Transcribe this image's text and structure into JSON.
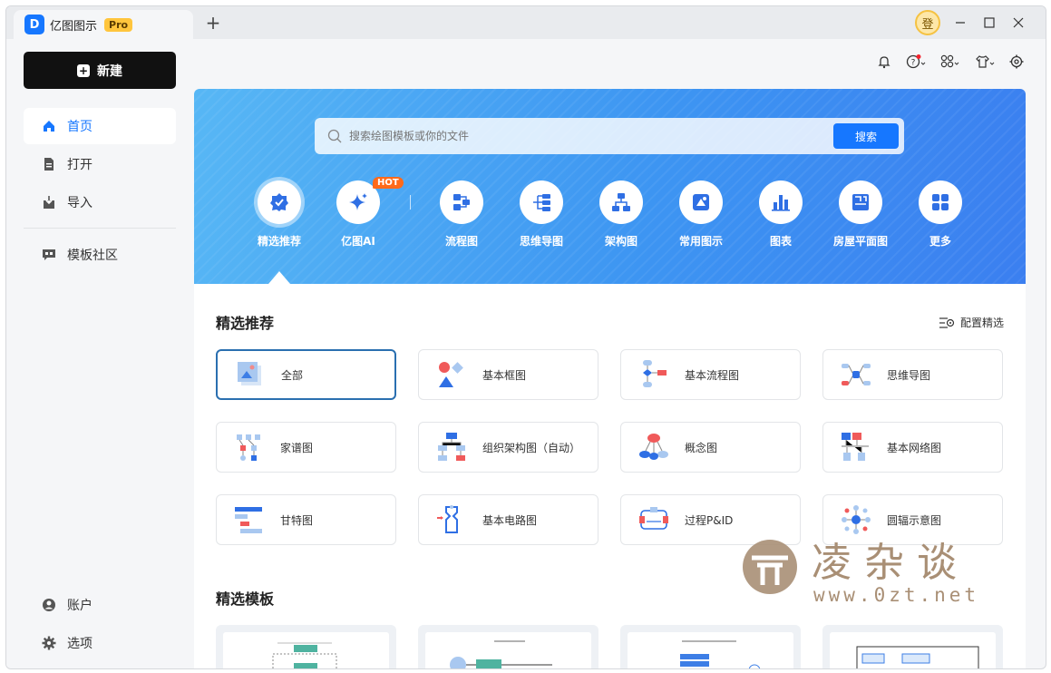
{
  "app": {
    "title": "亿图图示",
    "badge": "Pro",
    "logo_letter": "D",
    "tab_add": "+",
    "avatar_text": "登"
  },
  "sidebar": {
    "new_button": "新建",
    "items": [
      {
        "label": "首页",
        "icon": "home-icon",
        "active": true
      },
      {
        "label": "打开",
        "icon": "file-icon"
      },
      {
        "label": "导入",
        "icon": "import-icon"
      },
      {
        "label": "模板社区",
        "icon": "community-icon"
      }
    ],
    "bottom": [
      {
        "label": "账户",
        "icon": "account-icon"
      },
      {
        "label": "选项",
        "icon": "gear-icon"
      }
    ]
  },
  "search": {
    "placeholder": "搜索绘图模板或你的文件",
    "button": "搜索"
  },
  "categories": [
    {
      "label": "精选推荐",
      "icon": "featured-icon",
      "selected": true
    },
    {
      "label": "亿图AI",
      "icon": "ai-sparkle-icon",
      "badge": "HOT"
    },
    {
      "label": "流程图",
      "icon": "flowchart-icon"
    },
    {
      "label": "思维导图",
      "icon": "mindmap-icon"
    },
    {
      "label": "架构图",
      "icon": "org-chart-icon"
    },
    {
      "label": "常用图示",
      "icon": "common-diagram-icon"
    },
    {
      "label": "图表",
      "icon": "chart-icon"
    },
    {
      "label": "房屋平面图",
      "icon": "floor-plan-icon"
    },
    {
      "label": "更多",
      "icon": "more-grid-icon"
    }
  ],
  "featured": {
    "title": "精选推荐",
    "config_label": "配置精选",
    "cards": [
      {
        "label": "全部",
        "selected": true
      },
      {
        "label": "基本框图"
      },
      {
        "label": "基本流程图"
      },
      {
        "label": "思维导图"
      },
      {
        "label": "家谱图"
      },
      {
        "label": "组织架构图（自动）"
      },
      {
        "label": "概念图"
      },
      {
        "label": "基本网络图"
      },
      {
        "label": "甘特图"
      },
      {
        "label": "基本电路图"
      },
      {
        "label": "过程P&ID"
      },
      {
        "label": "圆辐示意图"
      }
    ]
  },
  "templates": {
    "title": "精选模板"
  },
  "watermark": {
    "text": "凌 杂 谈",
    "url": "www.0zt.net"
  },
  "colors": {
    "accent": "#1677ff",
    "banner_start": "#57b7f5",
    "banner_end": "#3b7ff0",
    "hot": "#ff6a1a"
  }
}
